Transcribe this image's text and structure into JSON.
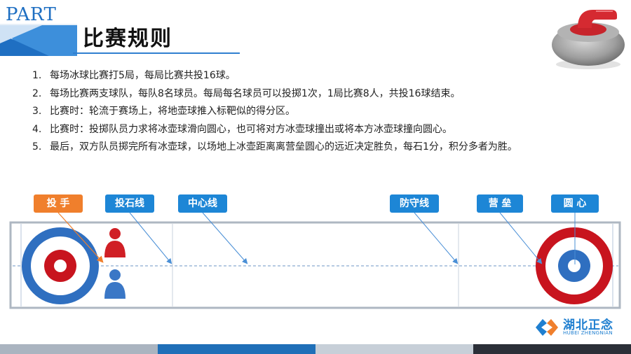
{
  "header": {
    "part_label": "PART",
    "title": "比赛规则"
  },
  "rules": [
    {
      "num": "1.",
      "text": "每场冰球比赛打5局，每局比赛共投16球。"
    },
    {
      "num": "2.",
      "text": "每场比赛两支球队，每队8名球员。每局每名球员可以投掷1次，1局比赛8人，共投16球结束。"
    },
    {
      "num": "3.",
      "text": "比赛时：轮流于赛场上，将地壶球推入标靶似的得分区。"
    },
    {
      "num": "4.",
      "text": "比赛时：投掷队员力求将冰壶球滑向圆心，也可将对方冰壶球撞出或将本方冰壶球撞向圆心。"
    },
    {
      "num": "5.",
      "text": "最后，双方队员掷完所有冰壶球，以场地上冰壶距离离营垒圆心的远近决定胜负，每石1分，积分多者为胜。"
    }
  ],
  "labels": {
    "thrower": "投 手",
    "hog_line": "投石线",
    "center_line": "中心线",
    "defense_line": "防守线",
    "house": "营 垒",
    "center": "圆 心"
  },
  "brand": {
    "name_cn": "湖北正念",
    "name_en": "HUBEI ZHENGNIAN"
  },
  "colors": {
    "accent_blue": "#1d86d6",
    "accent_orange": "#f07f2c",
    "ring_red": "#c8141e",
    "ring_blue": "#2f6fc0",
    "player_red": "#d01f25",
    "player_blue": "#3a77c6"
  },
  "footer_colors": [
    "#aab4c0",
    "#1f6fb8",
    "#c7cfd8",
    "#2b2f38"
  ],
  "icons": {
    "stone": "curling-stone-icon",
    "player_red": "person-icon",
    "player_blue": "person-icon",
    "brand": "brand-logo-icon"
  }
}
